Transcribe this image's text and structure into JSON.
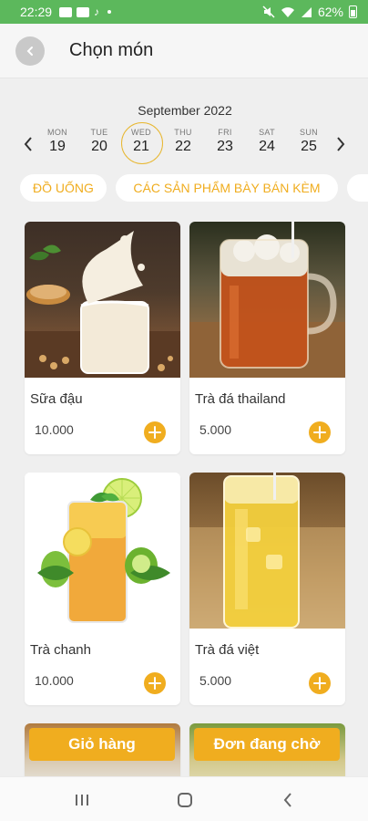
{
  "status_bar": {
    "time": "22:29",
    "battery": "62%"
  },
  "app_bar": {
    "back_icon": "chevron-left-icon",
    "title": "Chọn món"
  },
  "calendar": {
    "month_label": "September 2022",
    "prev_icon": "chevron-left-icon",
    "next_icon": "chevron-right-icon",
    "days": [
      {
        "name": "MON",
        "date": "19"
      },
      {
        "name": "TUE",
        "date": "20"
      },
      {
        "name": "WED",
        "date": "21"
      },
      {
        "name": "THU",
        "date": "22"
      },
      {
        "name": "FRI",
        "date": "23"
      },
      {
        "name": "SAT",
        "date": "24"
      },
      {
        "name": "SUN",
        "date": "25"
      }
    ],
    "selected_index": 2
  },
  "categories": [
    {
      "label": "ĐỒ UỐNG"
    },
    {
      "label": "CÁC SẢN PHẨM BÀY BÁN KÈM"
    }
  ],
  "products": [
    {
      "name": "Sữa đậu",
      "price": "10.000"
    },
    {
      "name": "Trà đá thailand",
      "price": "5.000"
    },
    {
      "name": "Trà chanh",
      "price": "10.000"
    },
    {
      "name": "Trà đá việt",
      "price": "5.000"
    }
  ],
  "actions": {
    "cart_label": "Giỏ hàng",
    "pending_label": "Đơn đang chờ"
  },
  "colors": {
    "status_bar": "#5cb85c",
    "accent": "#f0ad1f",
    "selected_ring": "#e8b730",
    "background": "#efefef"
  }
}
